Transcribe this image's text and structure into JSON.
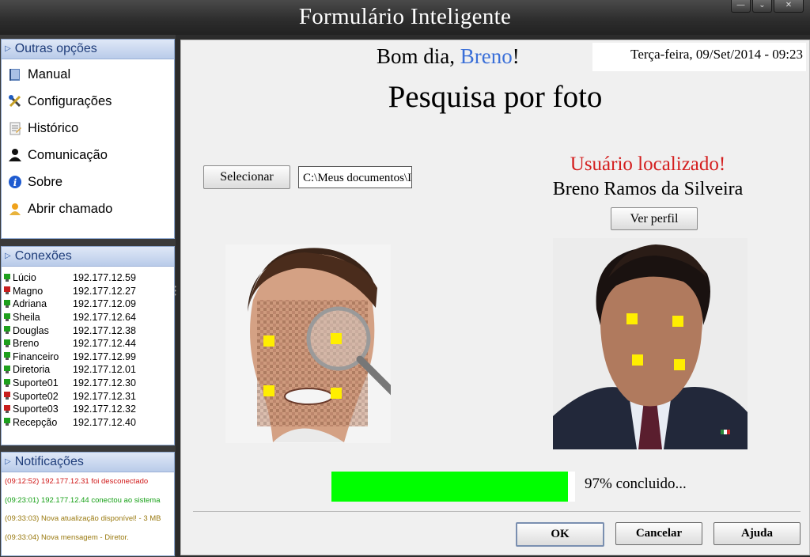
{
  "window": {
    "title": "Formulário Inteligente",
    "controls": [
      "minimize",
      "restore",
      "close"
    ]
  },
  "sidebar": {
    "options": {
      "title": "Outras opções",
      "items": [
        {
          "label": "Manual",
          "icon": "book-icon"
        },
        {
          "label": "Configurações",
          "icon": "tools-icon"
        },
        {
          "label": "Histórico",
          "icon": "history-icon"
        },
        {
          "label": "Comunicação",
          "icon": "user-icon"
        },
        {
          "label": "Sobre",
          "icon": "info-icon"
        },
        {
          "label": "Abrir chamado",
          "icon": "support-icon"
        }
      ]
    },
    "connections": {
      "title": "Conexões",
      "rows": [
        {
          "name": "Lúcio",
          "ip": "192.177.12.59",
          "online": true
        },
        {
          "name": "Magno",
          "ip": "192.177.12.27",
          "online": false
        },
        {
          "name": "Adriana",
          "ip": "192.177.12.09",
          "online": true
        },
        {
          "name": "Sheila",
          "ip": "192.177.12.64",
          "online": true
        },
        {
          "name": "Douglas",
          "ip": "192.177.12.38",
          "online": true
        },
        {
          "name": "Breno",
          "ip": "192.177.12.44",
          "online": true
        },
        {
          "name": "Financeiro",
          "ip": "192.177.12.99",
          "online": true
        },
        {
          "name": "Diretoria",
          "ip": "192.177.12.01",
          "online": true
        },
        {
          "name": "Suporte01",
          "ip": "192.177.12.30",
          "online": true
        },
        {
          "name": "Suporte02",
          "ip": "192.177.12.31",
          "online": false
        },
        {
          "name": "Suporte03",
          "ip": "192.177.12.32",
          "online": false
        },
        {
          "name": "Recepção",
          "ip": "192.177.12.40",
          "online": true
        }
      ]
    },
    "notifications": {
      "title": "Notificações",
      "items": [
        {
          "text": "(09:12:52) 192.177.12.31 foi desconectado",
          "color": "#d01818"
        },
        {
          "text": "(09:23:01) 192.177.12.44 conectou ao sistema",
          "color": "#16a016"
        },
        {
          "text": "(09:33:03) Nova atualização disponível! - 3 MB",
          "color": "#9a7a10"
        },
        {
          "text": "(09:33:04) Nova mensagem - Diretor.",
          "color": "#9a7a10"
        }
      ]
    }
  },
  "main": {
    "greeting_prefix": "Bom dia, ",
    "greeting_name": "Breno",
    "greeting_suffix": "!",
    "datetime": "Terça-feira, 09/Set/2014 - 09:23",
    "heading": "Pesquisa por foto",
    "select_label": "Selecionar",
    "file_path": "C:\\Meus documentos\\Im",
    "result_status": "Usuário localizado!",
    "result_name": "Breno Ramos da Silveira",
    "view_profile_label": "Ver perfil",
    "progress_fraction": 0.97,
    "progress_label": "97% concluido...",
    "buttons": {
      "ok": "OK",
      "cancel": "Cancelar",
      "help": "Ajuda"
    }
  },
  "colors": {
    "accent": "#3a6fd8",
    "found": "#d41e1e",
    "progress": "#00ff00",
    "online": "#1ea01e",
    "offline": "#c81e1e"
  }
}
